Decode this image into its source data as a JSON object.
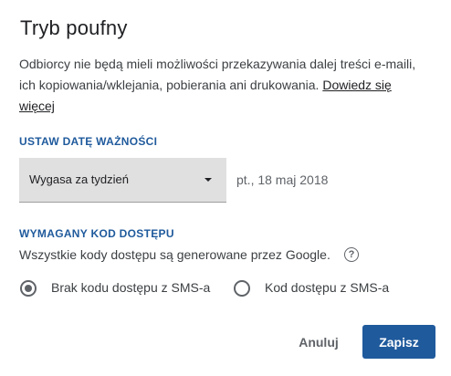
{
  "dialog": {
    "title": "Tryb poufny",
    "description": "Odbiorcy nie będą mieli możliwości przekazywania dalej treści e-maili, ich kopiowania/wklejania, pobierania ani drukowania. ",
    "learn_more": "Dowiedz się więcej"
  },
  "expiry": {
    "section_label": "USTAW DATĘ WAŻNOŚCI",
    "selected_option": "Wygasa za tydzień",
    "date": "pt., 18 maj 2018"
  },
  "passcode": {
    "section_label": "WYMAGANY KOD DOSTĘPU",
    "description": "Wszystkie kody dostępu są generowane przez Google.",
    "help_icon": "?",
    "options": [
      {
        "label": "Brak kodu dostępu z SMS-a",
        "selected": true
      },
      {
        "label": "Kod dostępu z SMS-a",
        "selected": false
      }
    ]
  },
  "actions": {
    "cancel_label": "Anuluj",
    "save_label": "Zapisz"
  },
  "colors": {
    "accent": "#1f5a9c",
    "text": "#3c4043",
    "select_bg": "#e0e0e0"
  }
}
